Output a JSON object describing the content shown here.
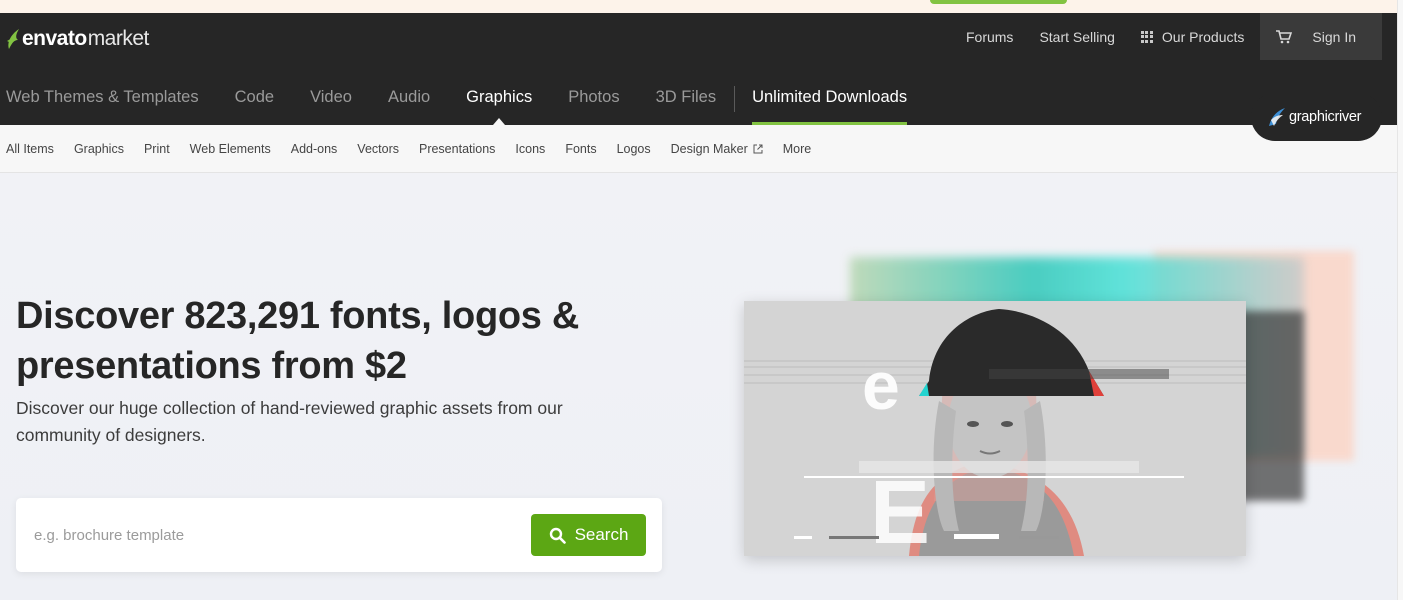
{
  "header": {
    "logo": {
      "word": "envato",
      "sub": "market"
    },
    "top_links": [
      "Forums",
      "Start Selling",
      "Our Products",
      "Sign In"
    ]
  },
  "categories": {
    "items": [
      "Web Themes & Templates",
      "Code",
      "Video",
      "Audio",
      "Graphics",
      "Photos",
      "3D Files"
    ],
    "active": "Graphics",
    "unlimited": "Unlimited Downloads"
  },
  "brand_badge": "graphicriver",
  "subnav": {
    "items": [
      "All Items",
      "Graphics",
      "Print",
      "Web Elements",
      "Add-ons",
      "Vectors",
      "Presentations",
      "Icons",
      "Fonts",
      "Logos",
      "Design Maker",
      "More"
    ]
  },
  "hero": {
    "headline": "Discover 823,291 fonts, logos & presentations from $2",
    "subhead": "Discover our huge collection of hand-reviewed graphic assets from our community of designers.",
    "search": {
      "placeholder": "e.g. brochure template",
      "button": "Search"
    }
  },
  "colors": {
    "accent_green": "#82c342",
    "search_green": "#5ca714",
    "header_dark": "#262626"
  }
}
